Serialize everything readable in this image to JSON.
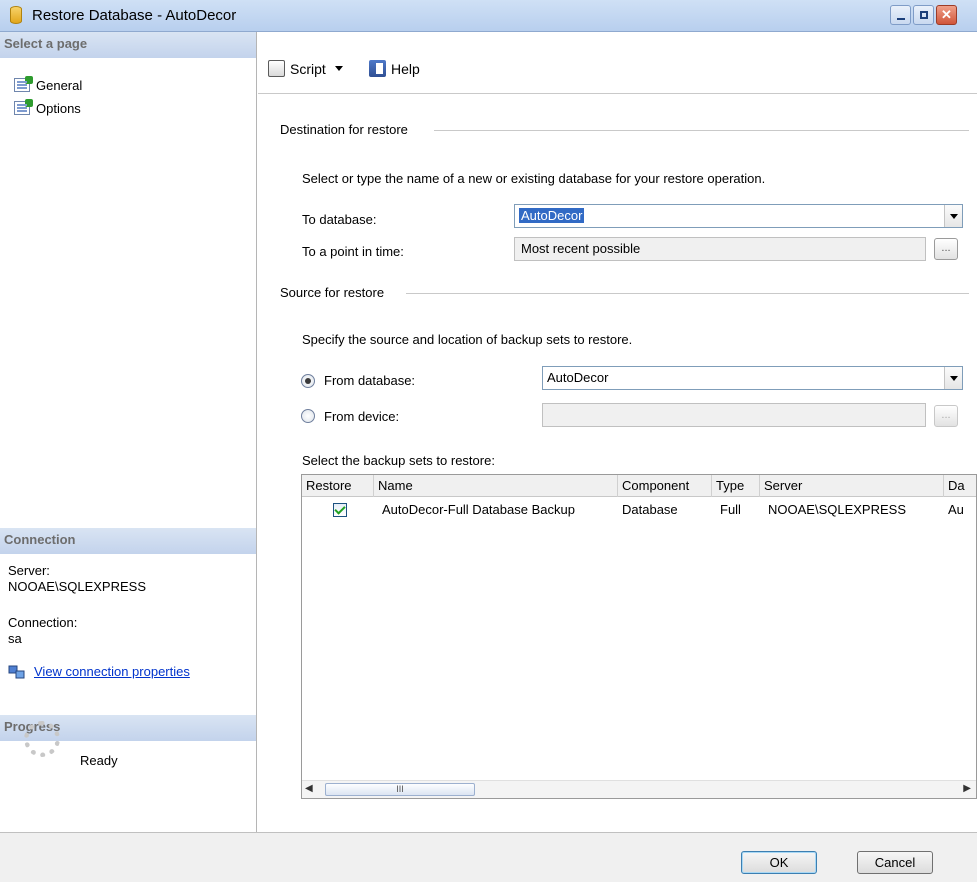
{
  "window": {
    "title": "Restore Database - AutoDecor"
  },
  "left": {
    "select_page_heading": "Select a page",
    "pages": [
      {
        "label": "General",
        "icon": "page-icon"
      },
      {
        "label": "Options",
        "icon": "page-icon"
      }
    ],
    "connection_heading": "Connection",
    "server_label": "Server:",
    "server_value": "NOOAE\\SQLEXPRESS",
    "connection_label": "Connection:",
    "connection_value": "sa",
    "view_props_link": "View connection properties",
    "progress_heading": "Progress",
    "progress_status": "Ready"
  },
  "toolbar": {
    "script_label": "Script",
    "help_label": "Help"
  },
  "destination": {
    "heading": "Destination for restore",
    "instruction": "Select or type the name of a new or existing database for your restore operation.",
    "to_database_label": "To database:",
    "to_database_value": "AutoDecor",
    "point_in_time_label": "To a point in time:",
    "point_in_time_value": "Most recent possible",
    "ellipsis": "..."
  },
  "source": {
    "heading": "Source for restore",
    "instruction": "Specify the source and location of backup sets to restore.",
    "from_database_label": "From database:",
    "from_database_value": "AutoDecor",
    "from_device_label": "From device:",
    "from_device_value": "",
    "selected_option": "from_database",
    "backup_sets_label": "Select the backup sets to restore:"
  },
  "grid": {
    "columns": [
      "Restore",
      "Name",
      "Component",
      "Type",
      "Server",
      "Da"
    ],
    "rows": [
      {
        "restore": true,
        "name": "AutoDecor-Full Database Backup",
        "component": "Database",
        "type": "Full",
        "server": "NOOAE\\SQLEXPRESS",
        "database": "Au"
      }
    ],
    "scroll_thumb_glyph": "III"
  },
  "footer": {
    "ok_label": "OK",
    "cancel_label": "Cancel"
  },
  "colors": {
    "titlebar": "#c3d6f0",
    "section_header": "#c9d7ec",
    "link": "#0033cc",
    "selection": "#316ac5"
  }
}
